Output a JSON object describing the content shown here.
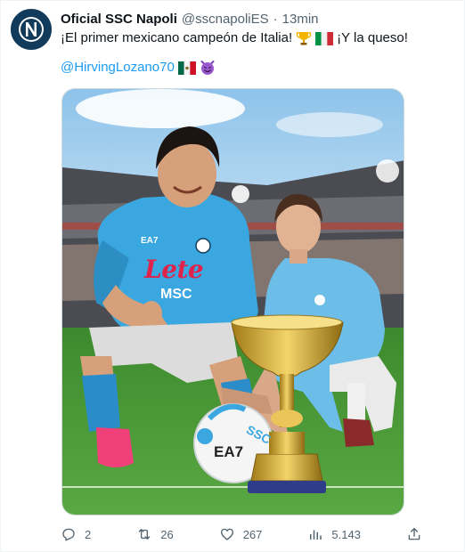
{
  "tweet": {
    "author_name": "Oficial SSC Napoli",
    "handle": "@sscnapoliES",
    "separator": "·",
    "time": "13min",
    "text_part1": "¡El primer mexicano campeón de Italia!",
    "text_part2": "¡Y la queso!",
    "mention": "@HirvingLozano70",
    "emojis_line1": [
      "trophy",
      "flag-italy"
    ],
    "emojis_line2": [
      "flag-mexico",
      "smiling-imp"
    ]
  },
  "media": {
    "jersey_sponsor": "Lete",
    "jersey_text": "MSC",
    "jersey_brand": "EA7",
    "ball_text": "EA7",
    "ball_text2": "SSC"
  },
  "actions": {
    "reply_count": "2",
    "retweet_count": "26",
    "like_count": "267",
    "views_count": "5.143"
  },
  "colors": {
    "accent": "#1d9bf0",
    "text": "#0f1419",
    "muted": "#536471",
    "napoli_blue": "#3aa7e0",
    "napoli_navy": "#123a5a"
  }
}
